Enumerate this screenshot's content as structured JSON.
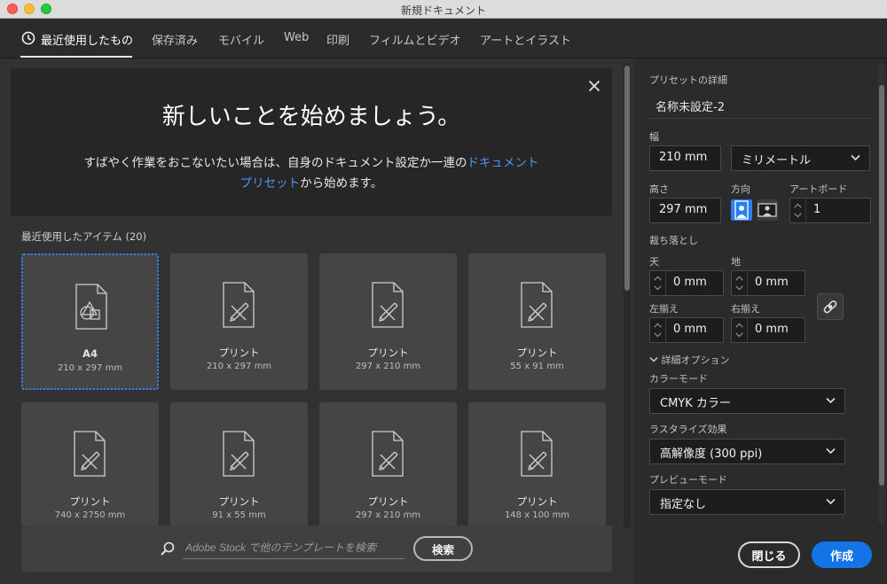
{
  "window": {
    "title": "新規ドキュメント"
  },
  "tabs": [
    {
      "label": "最近使用したもの",
      "active": true
    },
    {
      "label": "保存済み"
    },
    {
      "label": "モバイル"
    },
    {
      "label": "Web"
    },
    {
      "label": "印刷"
    },
    {
      "label": "フィルムとビデオ"
    },
    {
      "label": "アートとイラスト"
    }
  ],
  "hero": {
    "title": "新しいことを始めましょう。",
    "text_before": "すばやく作業をおこないたい場合は、自身のドキュメント設定か一連の",
    "link": "ドキュメントプリセット",
    "text_after": "から始めます。"
  },
  "recent": {
    "label": "最近使用したアイテム (20)",
    "items": [
      {
        "name": "A4",
        "size": "210 x 297 mm",
        "icon": "shapes-doc-icon",
        "selected": true
      },
      {
        "name": "プリント",
        "size": "210 x 297 mm",
        "icon": "pencil-doc-icon"
      },
      {
        "name": "プリント",
        "size": "297 x 210 mm",
        "icon": "pencil-doc-icon"
      },
      {
        "name": "プリント",
        "size": "55 x 91 mm",
        "icon": "pencil-doc-icon"
      },
      {
        "name": "プリント",
        "size": "740 x 2750 mm",
        "icon": "pencil-doc-icon"
      },
      {
        "name": "プリント",
        "size": "91 x 55 mm",
        "icon": "pencil-doc-icon"
      },
      {
        "name": "プリント",
        "size": "297 x 210 mm",
        "icon": "pencil-doc-icon"
      },
      {
        "name": "プリント",
        "size": "148 x 100 mm",
        "icon": "pencil-doc-icon"
      }
    ]
  },
  "search": {
    "placeholder": "Adobe Stock で他のテンプレートを検索",
    "button": "検索"
  },
  "preset": {
    "section_label": "プリセットの詳細",
    "name": "名称未設定-2",
    "width_label": "幅",
    "width_value": "210 mm",
    "unit": "ミリメートル",
    "height_label": "高さ",
    "height_value": "297 mm",
    "orientation_label": "方向",
    "artboard_label": "アートボード",
    "artboard_value": "1",
    "bleed_label": "裁ち落とし",
    "bleed_top_label": "天",
    "bleed_top": "0 mm",
    "bleed_bottom_label": "地",
    "bleed_bottom": "0 mm",
    "bleed_left_label": "左揃え",
    "bleed_left": "0 mm",
    "bleed_right_label": "右揃え",
    "bleed_right": "0 mm",
    "advanced_label": "詳細オプション",
    "color_mode_label": "カラーモード",
    "color_mode": "CMYK カラー",
    "raster_label": "ラスタライズ効果",
    "raster": "高解像度 (300 ppi)",
    "preview_label": "プレビューモード",
    "preview": "指定なし"
  },
  "actions": {
    "close": "閉じる",
    "create": "作成"
  },
  "colors": {
    "accent": "#1473e6",
    "link": "#4d94f5",
    "selection": "#2f84f2"
  }
}
